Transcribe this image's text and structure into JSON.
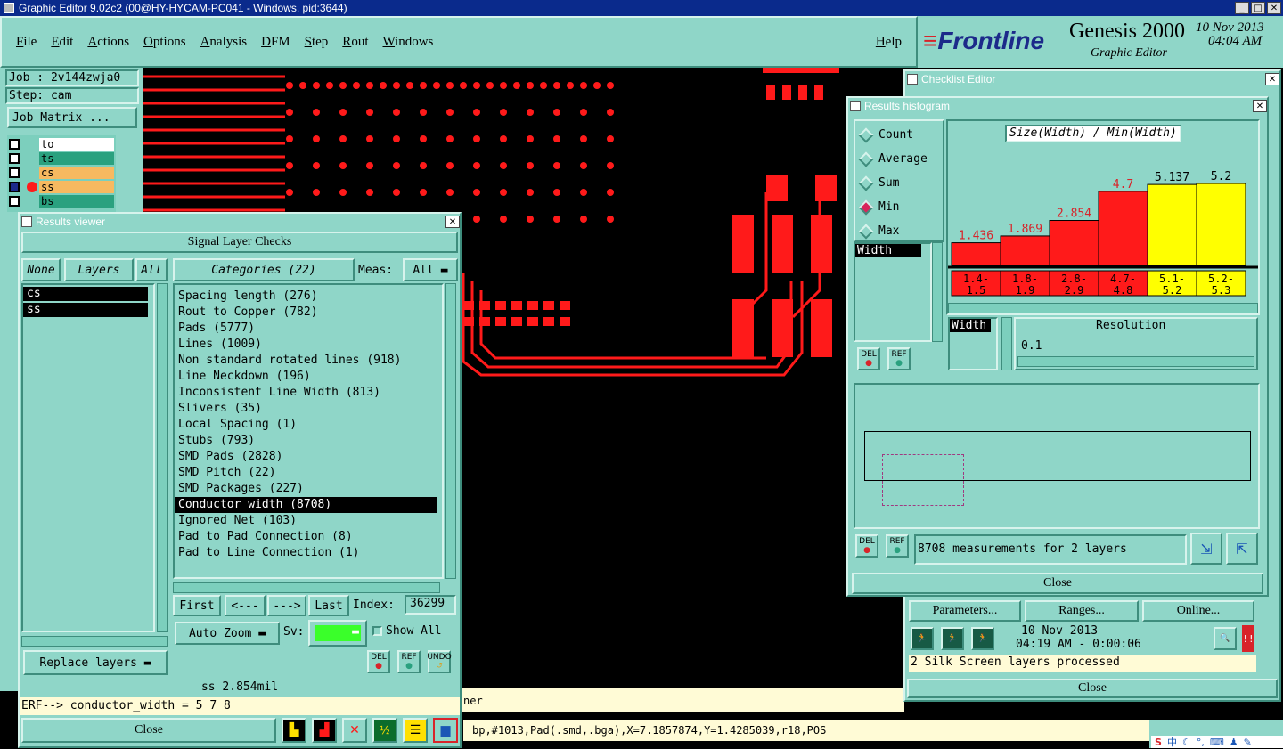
{
  "window_title": "Graphic Editor 9.02c2 (00@HY-HYCAM-PC041 - Windows, pid:3644)",
  "menu": [
    "File",
    "Edit",
    "Actions",
    "Options",
    "Analysis",
    "DFM",
    "Step",
    "Rout",
    "Windows"
  ],
  "help": "Help",
  "brand": {
    "logo": "Frontline",
    "product": "Genesis 2000",
    "subtitle": "Graphic Editor",
    "date": "10 Nov 2013",
    "time": "04:04 AM"
  },
  "left_panel": {
    "job": "Job : 2v144zwja0",
    "step": "Step: cam",
    "job_matrix": "Job Matrix ..."
  },
  "layers": [
    {
      "name": "to",
      "color": "#ffffff"
    },
    {
      "name": "ts",
      "color": "#2aa17f"
    },
    {
      "name": "cs",
      "color": "#f7b960"
    },
    {
      "name": "ss",
      "color": "#f7b960"
    },
    {
      "name": "bs",
      "color": "#2aa17f"
    }
  ],
  "results_viewer": {
    "title": "Results viewer",
    "header": "Signal Layer Checks",
    "none": "None",
    "layers_label": "Layers",
    "all": "All",
    "layer_list": [
      "cs",
      "ss"
    ],
    "categories_label": "Categories (22)",
    "meas_label": "Meas:",
    "meas_value": "All",
    "categories": [
      "Spacing length (276)",
      "Rout to Copper (782)",
      "Pads (5777)",
      "Lines (1009)",
      "Non standard rotated lines (918)",
      "Line Neckdown (196)",
      "Inconsistent Line Width (813)",
      "Slivers (35)",
      "Local Spacing (1)",
      "Stubs (793)",
      "SMD Pads (2828)",
      "SMD Pitch (22)",
      "SMD Packages (227)",
      "Conductor width (8708)",
      "Ignored Net (103)",
      "Pad to Pad Connection (8)",
      "Pad to Line Connection (1)"
    ],
    "selected_category": "Conductor width (8708)",
    "nav": {
      "first": "First",
      "prev": "<---",
      "next": "--->",
      "last": "Last",
      "index_label": "Index:",
      "index_value": "36299"
    },
    "auto_zoom": "Auto Zoom",
    "sv_label": "Sv:",
    "show_all": "Show All",
    "replace_layers": "Replace layers",
    "status": "ss 2.854mil",
    "erf": "ERF--> conductor_width = 5 7 8",
    "close": "Close",
    "del": "DEL",
    "ref": "REF",
    "undo": "UNDO"
  },
  "checklist_editor": {
    "title": "Checklist Editor",
    "parameters": "Parameters...",
    "ranges": "Ranges...",
    "online": "Online...",
    "date": "10 Nov 2013",
    "time": "04:19 AM - 0:00:06",
    "status": "2 Silk Screen layers processed",
    "close": "Close"
  },
  "histogram": {
    "title": "Results histogram",
    "modes": [
      "Count",
      "Average",
      "Sum",
      "Min",
      "Max"
    ],
    "selected_mode": "Min",
    "field": "Width",
    "heading": "Size(Width) / Min(Width)",
    "resolution_label": "Resolution",
    "resolution_value": "0.1",
    "measurements": "8708 measurements for 2 layers",
    "close": "Close",
    "del": "DEL",
    "ref": "REF"
  },
  "chart_data": {
    "type": "bar",
    "title": "Size(Width) / Min(Width)",
    "categories": [
      "1.4-1.5",
      "1.8-1.9",
      "2.8-2.9",
      "4.7-4.8",
      "5.1-5.2",
      "5.2-5.3"
    ],
    "values": [
      1.436,
      1.869,
      2.854,
      4.7,
      5.137,
      5.2
    ],
    "value_labels": [
      "1.436",
      "1.869",
      "2.854",
      "4.7",
      "5.137",
      "5.2"
    ],
    "category_labels": [
      [
        "1.4-",
        "1.5"
      ],
      [
        "1.8-",
        "1.9"
      ],
      [
        "2.8-",
        "2.9"
      ],
      [
        "4.7-",
        "4.8"
      ],
      [
        "5.1-",
        "5.2"
      ],
      [
        "5.2-",
        "5.3"
      ]
    ],
    "colors": [
      "#ff1a1a",
      "#ff1a1a",
      "#ff1a1a",
      "#ff1a1a",
      "#ffff00",
      "#ffff00"
    ],
    "ylim": [
      0,
      5.2
    ]
  },
  "bottom_status": "bp,#1013,Pad(.smd,.bga),X=7.1857874,Y=1.4285039,r18,POS",
  "partial_label": "ner",
  "tray": [
    "中"
  ]
}
